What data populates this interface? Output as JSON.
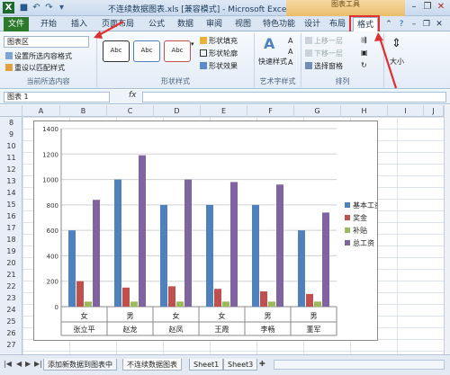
{
  "titlebar": {
    "title": "不连续数据图表.xls [兼容模式] - Microsoft Excel",
    "context_group": "图表工具"
  },
  "tabs": [
    "文件",
    "开始",
    "插入",
    "页面布局",
    "公式",
    "数据",
    "审阅",
    "视图",
    "特色功能",
    "设计",
    "布局",
    "格式"
  ],
  "ribbon": {
    "selection_box": "图表区",
    "format_selection": "设置所选内容格式",
    "reset_style": "重设以匹配样式",
    "group_current": "当前所选内容",
    "shape_style_sample": "Abc",
    "shape_fill": "形状填充",
    "shape_outline": "形状轮廓",
    "shape_effect": "形状效果",
    "group_shape_style": "形状样式",
    "quick_style": "快速样式",
    "group_art": "艺术字样式",
    "bring_forward": "上移一层",
    "send_backward": "下移一层",
    "selection_pane": "选择窗格",
    "group_arrange": "排列",
    "size": "大小"
  },
  "formula_bar": {
    "name_box": "图表 1",
    "fx": "fx"
  },
  "columns": [
    "A",
    "B",
    "C",
    "D",
    "E",
    "F",
    "G",
    "H",
    "I",
    "J"
  ],
  "rows": [
    "8",
    "9",
    "10",
    "11",
    "12",
    "13",
    "14",
    "15",
    "16",
    "17",
    "18",
    "19",
    "20",
    "21",
    "22",
    "23",
    "24",
    "25",
    "26",
    "27"
  ],
  "sheet_tabs": [
    "添加新数据到图表中",
    "不连续数据图表",
    "Sheet1",
    "Sheet3"
  ],
  "colors": {
    "basic": "#4f81bd",
    "bonus": "#c0504d",
    "subsidy": "#9bbb59",
    "total": "#8064a2",
    "accent_red": "#e03030",
    "file_tab": "#2b7a2b"
  },
  "chart_data": {
    "type": "bar",
    "categories": [
      "张立平",
      "赵龙",
      "赵凤",
      "王霞",
      "李畅",
      "董军"
    ],
    "genders": [
      "女",
      "男",
      "女",
      "女",
      "男",
      "男"
    ],
    "series": [
      {
        "name": "基本工资",
        "values": [
          600,
          1000,
          800,
          800,
          800,
          600
        ]
      },
      {
        "name": "奖金",
        "values": [
          200,
          150,
          160,
          140,
          120,
          100
        ]
      },
      {
        "name": "补贴",
        "values": [
          40,
          40,
          40,
          40,
          40,
          40
        ]
      },
      {
        "name": "总工资",
        "values": [
          840,
          1190,
          1000,
          980,
          960,
          740
        ]
      }
    ],
    "ylim": [
      0,
      1400
    ],
    "yticks": [
      "0",
      "200",
      "400",
      "600",
      "800",
      "1000",
      "1200",
      "1400"
    ],
    "legend": "right",
    "grid": true
  }
}
